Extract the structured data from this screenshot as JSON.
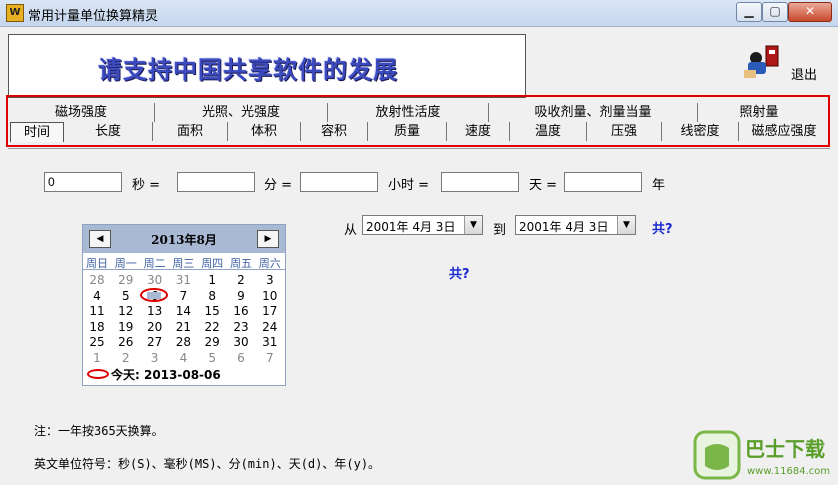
{
  "window": {
    "title": "常用计量单位换算精灵",
    "minimize": "▁",
    "maximize": "▢",
    "close": "✕"
  },
  "banner": {
    "text": "请支持中国共享软件的发展"
  },
  "exit": {
    "label": "退出"
  },
  "tabs_row1": [
    "磁场强度",
    "光照、光强度",
    "放射性活度",
    "吸收剂量、剂量当量",
    "照射量"
  ],
  "tabs_row2": [
    "时间",
    "长度",
    "面积",
    "体积",
    "容积",
    "质量",
    "速度",
    "温度",
    "压强",
    "线密度",
    "磁感应强度"
  ],
  "converter": {
    "seconds_value": "0",
    "seconds_label": "秒 =",
    "minutes_value": "",
    "minutes_label": "分 =",
    "hours_value": "",
    "hours_label": "小时 =",
    "days_value": "",
    "days_label": "天 =",
    "years_value": "",
    "years_label": "年"
  },
  "range": {
    "from_label": "从",
    "from_date": "2001年 4月 3日",
    "to_label": "到",
    "to_date": "2001年 4月 3日",
    "total_link": "共?",
    "total_result": "共?"
  },
  "calendar": {
    "title": "2013年8月",
    "prev": "◀",
    "next": "▶",
    "weekdays": [
      "周日",
      "周一",
      "周二",
      "周三",
      "周四",
      "周五",
      "周六"
    ],
    "weeks": [
      [
        "28",
        "29",
        "30",
        "31",
        "1",
        "2",
        "3"
      ],
      [
        "4",
        "5",
        "6",
        "7",
        "8",
        "9",
        "10"
      ],
      [
        "11",
        "12",
        "13",
        "14",
        "15",
        "16",
        "17"
      ],
      [
        "18",
        "19",
        "20",
        "21",
        "22",
        "23",
        "24"
      ],
      [
        "25",
        "26",
        "27",
        "28",
        "29",
        "30",
        "31"
      ],
      [
        "1",
        "2",
        "3",
        "4",
        "5",
        "6",
        "7"
      ]
    ],
    "today_label": "今天: 2013-08-06"
  },
  "notes": {
    "line1": "注：一年按365天换算。",
    "line2": "英文单位符号：秒(S)、毫秒(MS)、分(min)、天(d)、年(y)。"
  },
  "watermark": {
    "brand": "巴士下载",
    "url": "www.11684.com"
  },
  "colors": {
    "accent_red": "#e00000",
    "link_blue": "#1a2ad0",
    "calendar_header": "#a9b9d4"
  }
}
